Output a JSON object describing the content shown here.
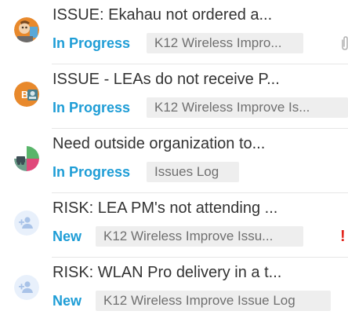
{
  "issues": [
    {
      "title": "ISSUE: Ekahau not ordered a...",
      "status": "In Progress",
      "tag": "K12 Wireless Impro...",
      "avatar": "photo-avatar-orange",
      "extra_icon": "paperclip-icon"
    },
    {
      "title": "ISSUE - LEAs do not receive P...",
      "status": "In Progress",
      "tag": "K12 Wireless Improve Is...",
      "avatar": "initial-avatar-b",
      "avatar_initial": "B"
    },
    {
      "title": "Need outside organization to...",
      "status": "In Progress",
      "tag": "Issues Log",
      "avatar": "group-avatar-pink-green"
    },
    {
      "title": "RISK: LEA PM's not attending ...",
      "status": "New",
      "tag": "K12 Wireless Improve Issu...",
      "avatar": "unassigned-user-icon",
      "extra_icon": "exclamation-icon",
      "extra_text": "!"
    },
    {
      "title": "RISK: WLAN Pro delivery in a t...",
      "status": "New",
      "tag": "K12 Wireless Improve Issue Log",
      "avatar": "unassigned-user-icon"
    }
  ],
  "colors": {
    "status": "#1e9dd6",
    "tag_bg": "#eeeeee",
    "alert": "#e2231a"
  }
}
